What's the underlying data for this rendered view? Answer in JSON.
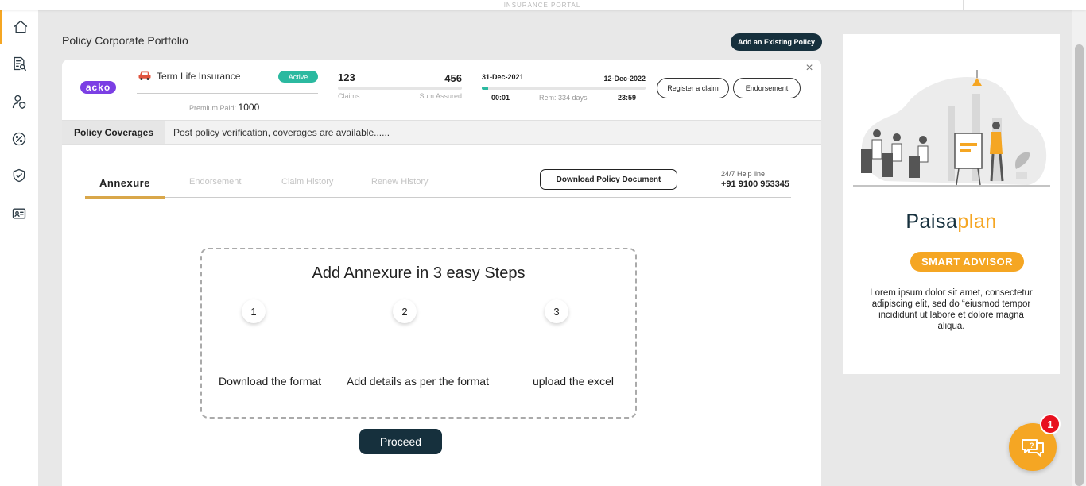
{
  "header": {
    "portal_text": "INSURANCE PORTAL"
  },
  "sidebar": {
    "items": [
      {
        "name": "home",
        "icon": "home-icon"
      },
      {
        "name": "policy-search",
        "icon": "document-search-icon"
      },
      {
        "name": "user-shield",
        "icon": "user-shield-icon"
      },
      {
        "name": "discount",
        "icon": "percent-badge-icon"
      },
      {
        "name": "claims",
        "icon": "shield-check-icon"
      },
      {
        "name": "id-card",
        "icon": "id-card-icon"
      }
    ]
  },
  "page": {
    "title": "Policy Corporate Portfolio",
    "add_policy_label": "Add an Existing Policy"
  },
  "policy": {
    "insurer": "acko",
    "product": "Term Life Insurance",
    "status": "Active",
    "premium_label": "Premium Paid:",
    "premium_value": "1000",
    "claims_value": "123",
    "claims_label": "Claims",
    "sum_value": "456",
    "sum_label": "Sum Assured",
    "start_date": "31-Dec-2021",
    "end_date": "12-Dec-2022",
    "start_time": "00:01",
    "remaining": "Rem: 334 days",
    "end_time": "23:59",
    "progress_fraction": 0.04,
    "register_claim_label": "Register a claim",
    "endorsement_label": "Endorsement",
    "close_symbol": "×"
  },
  "coverages": {
    "label": "Policy Coverages",
    "text": "Post policy verification, coverages are available......"
  },
  "tabs": [
    {
      "label": "Annexure",
      "active": true
    },
    {
      "label": "Endorsement",
      "active": false
    },
    {
      "label": "Claim History",
      "active": false
    },
    {
      "label": "Renew History",
      "active": false
    }
  ],
  "download_label": "Download Policy Document",
  "helpline": {
    "label": "24/7 Help line",
    "number": "+91 9100 953345"
  },
  "annexure": {
    "title": "Add Annexure in 3 easy Steps",
    "steps": [
      {
        "num": "1",
        "label": "Download the format"
      },
      {
        "num": "2",
        "label": "Add details as per the format"
      },
      {
        "num": "3",
        "label": "upload the excel"
      }
    ],
    "proceed_label": "Proceed"
  },
  "ad": {
    "brand_part1": "Paisa",
    "brand_part2": "plan",
    "badge": "SMART ADVISOR",
    "description": "Lorem ipsum dolor sit amet, consectetur adipiscing elit, sed do “eiusmod tempor incididunt ut labore et dolore magna aliqua."
  },
  "chat": {
    "badge_count": "1"
  },
  "colors": {
    "accent": "#f5a623",
    "navy": "#16303d",
    "teal": "#2bb9a0",
    "badge_red": "#e8101e"
  }
}
